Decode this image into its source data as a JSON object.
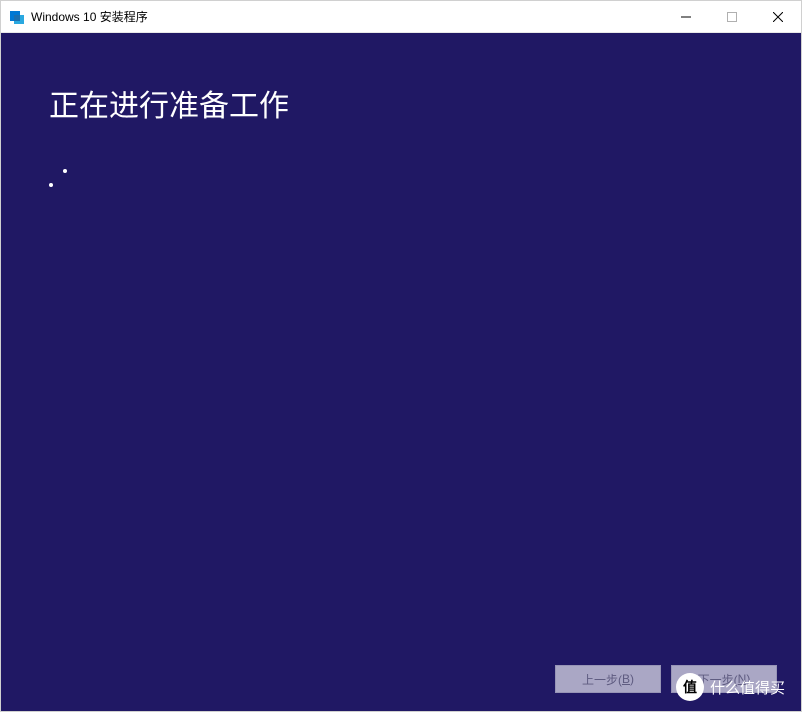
{
  "titlebar": {
    "title": "Windows 10 安装程序"
  },
  "content": {
    "heading": "正在进行准备工作"
  },
  "buttons": {
    "back_prefix": "上一步(",
    "back_accel": "B",
    "back_suffix": ")",
    "next_prefix": "下一步(",
    "next_accel": "N",
    "next_suffix": ")"
  },
  "watermark": {
    "badge": "值",
    "text": "什么值得买"
  }
}
